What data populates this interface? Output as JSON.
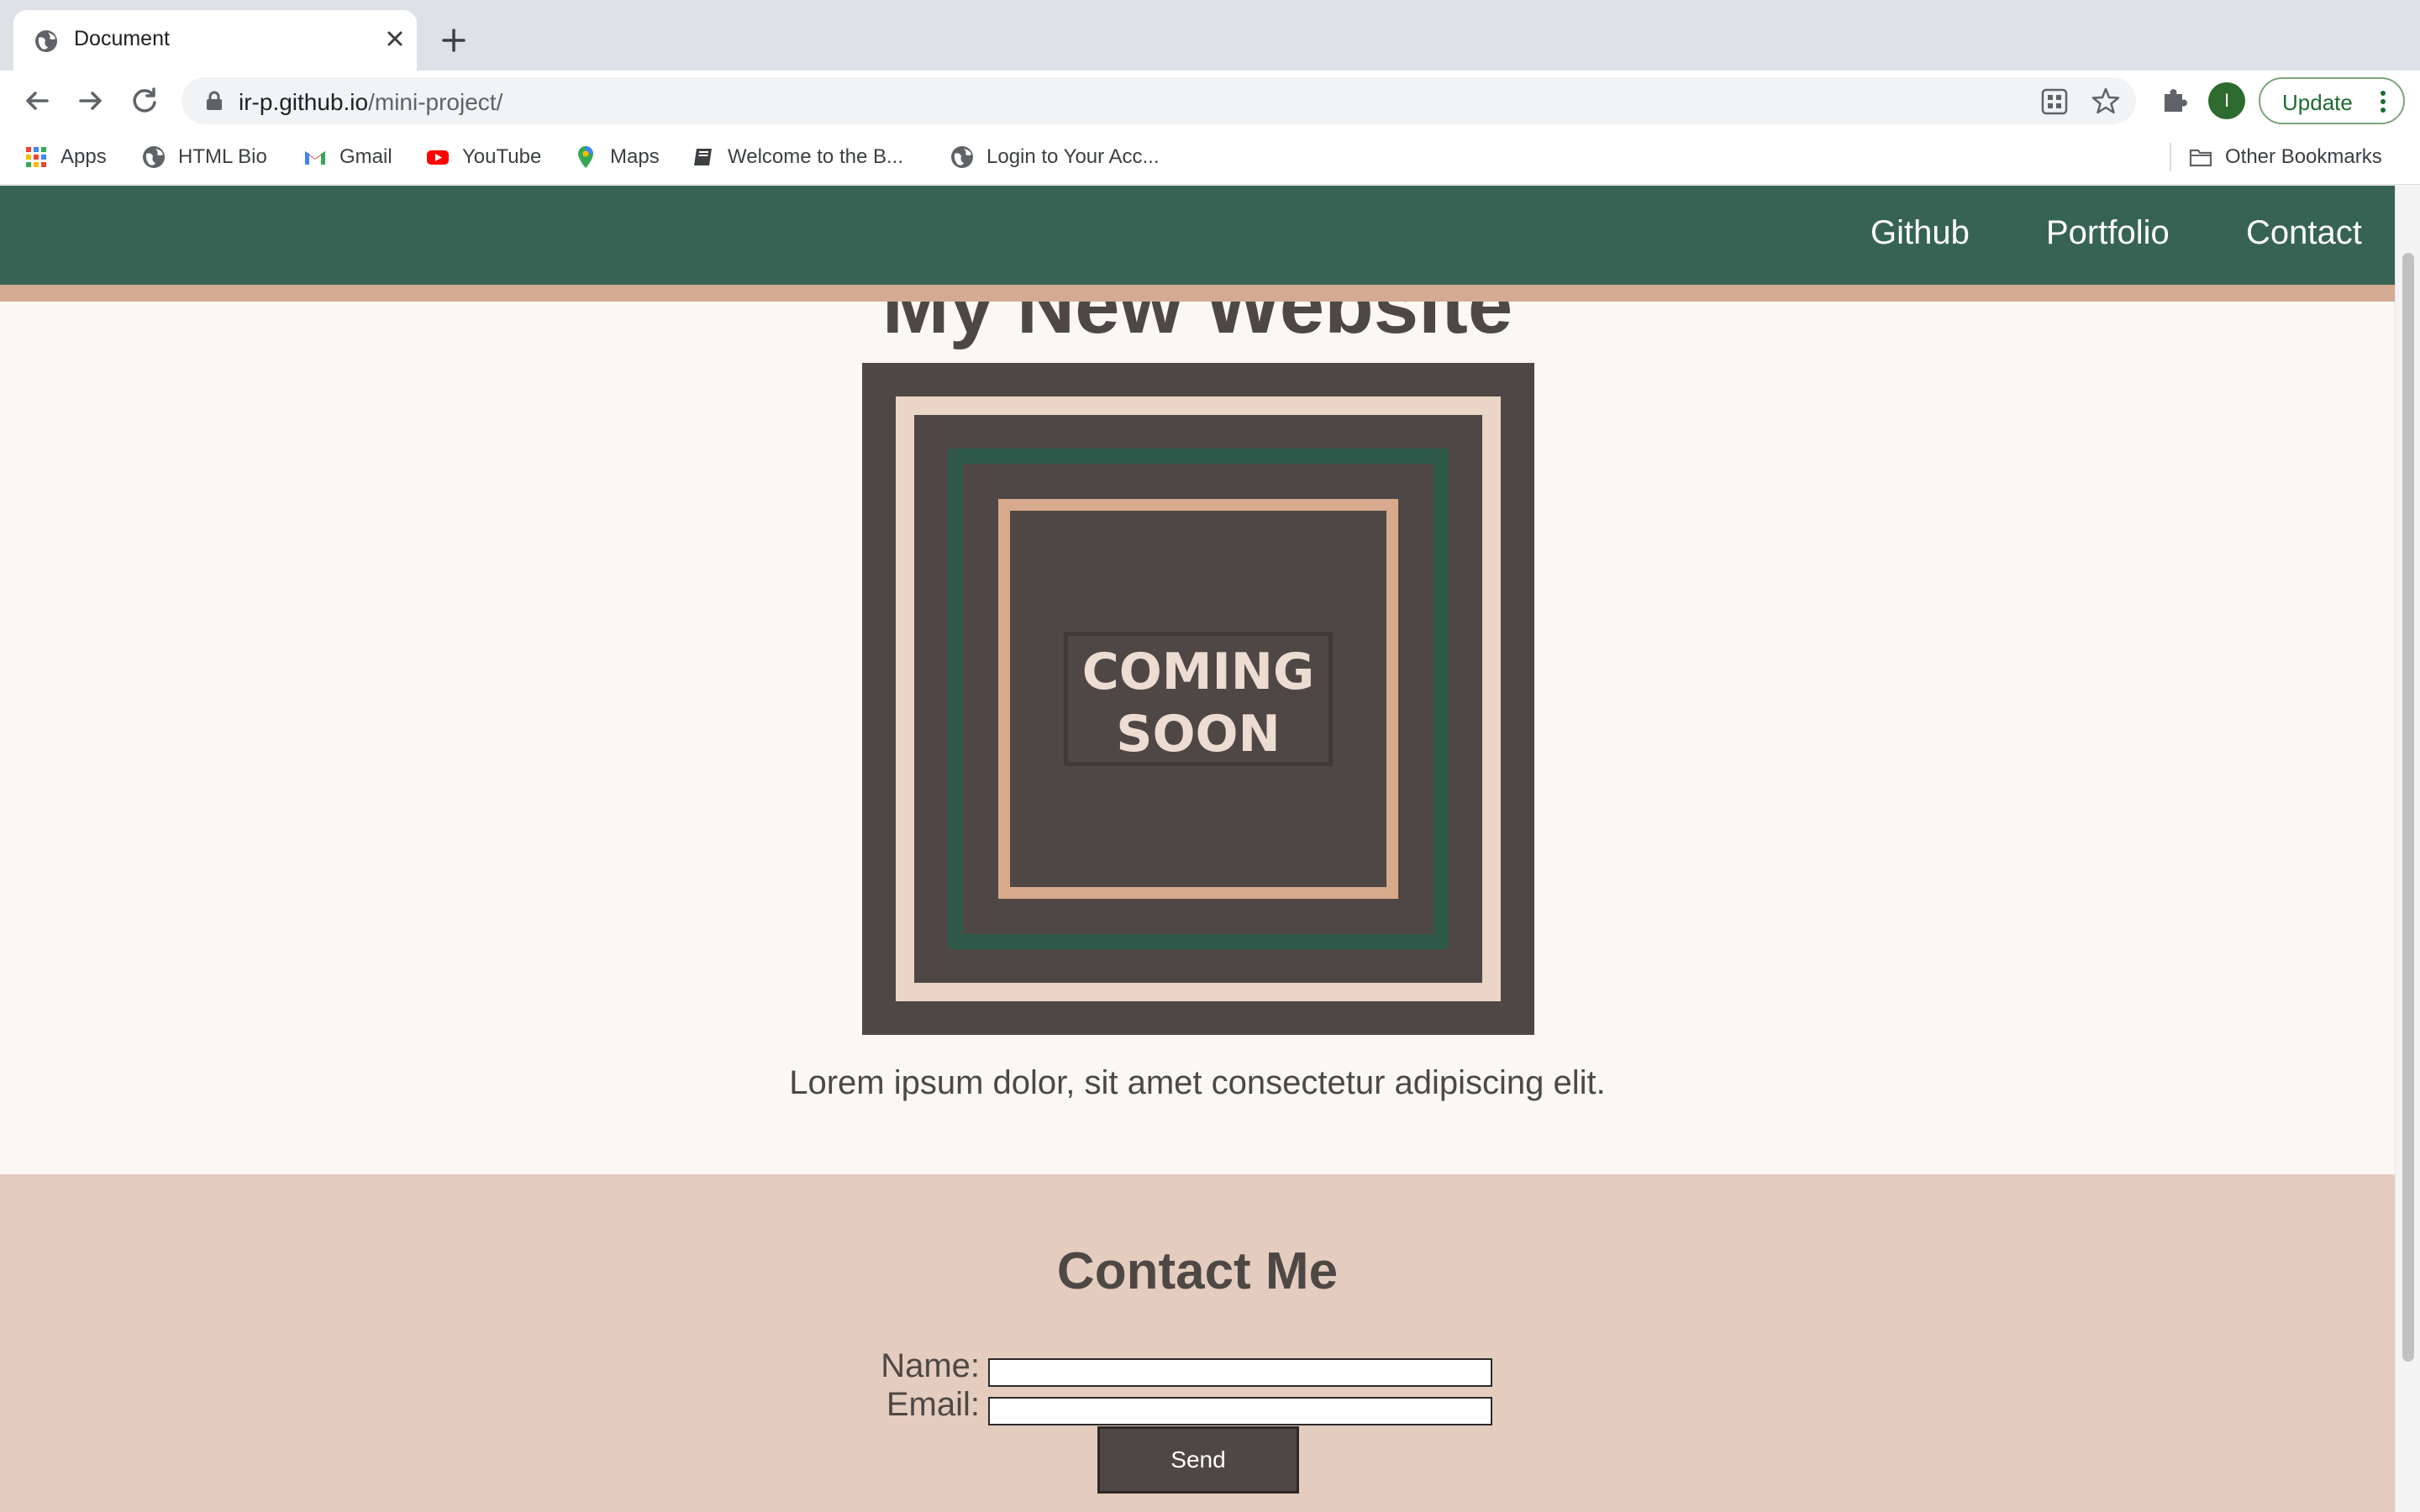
{
  "browser": {
    "tab_title": "Document",
    "url_host": "ir-p.github.io",
    "url_path": "/mini-project/",
    "profile_initial": "I",
    "update_label": "Update",
    "bookmarks": [
      {
        "label": "Apps",
        "icon": "apps-grid-icon"
      },
      {
        "label": "HTML Bio",
        "icon": "globe-icon"
      },
      {
        "label": "Gmail",
        "icon": "gmail-icon"
      },
      {
        "label": "YouTube",
        "icon": "youtube-icon"
      },
      {
        "label": "Maps",
        "icon": "maps-pin-icon"
      },
      {
        "label": "Welcome to the B...",
        "icon": "book-icon"
      },
      {
        "label": "Login to Your Acc...",
        "icon": "globe-icon"
      }
    ],
    "other_bookmarks": "Other Bookmarks"
  },
  "page": {
    "nav": {
      "github": "Github",
      "portfolio": "Portfolio",
      "contact": "Contact"
    },
    "hero_title": "My New Website",
    "image_text_line1": "COMING",
    "image_text_line2": "SOON",
    "intro": "Lorem ipsum dolor, sit amet consectetur adipiscing elit.",
    "contact": {
      "heading": "Contact Me",
      "name_label": "Name:",
      "email_label": "Email:",
      "send_label": "Send"
    }
  },
  "colors": {
    "nav_bg": "#376355",
    "accent_tan": "#d3ab92",
    "contact_bg": "#e4ccbf",
    "dark": "#4f4745"
  }
}
